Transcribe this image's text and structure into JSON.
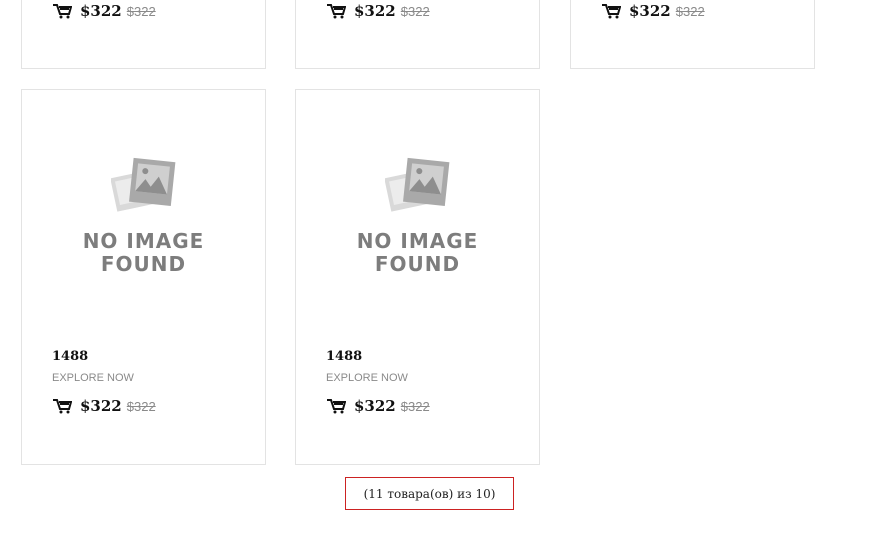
{
  "products": [
    {
      "price": "$322",
      "old_price": "$322"
    },
    {
      "price": "$322",
      "old_price": "$322"
    },
    {
      "price": "$322",
      "old_price": "$322"
    },
    {
      "placeholder_line1": "NO IMAGE",
      "placeholder_line2": "FOUND",
      "title": "1488",
      "link": "EXPLORE NOW",
      "price": "$322",
      "old_price": "$322"
    },
    {
      "placeholder_line1": "NO IMAGE",
      "placeholder_line2": "FOUND",
      "title": "1488",
      "link": "EXPLORE NOW",
      "price": "$322",
      "old_price": "$322"
    }
  ],
  "pagination": {
    "result_count": "(11 товара(ов) из 10)"
  },
  "icons": {
    "cart": "cart-icon",
    "placeholder": "photo-placeholder-icon"
  },
  "colors": {
    "border": "#e3e3e3",
    "highlight_border": "#cc2222",
    "muted": "#8a8a8a"
  }
}
